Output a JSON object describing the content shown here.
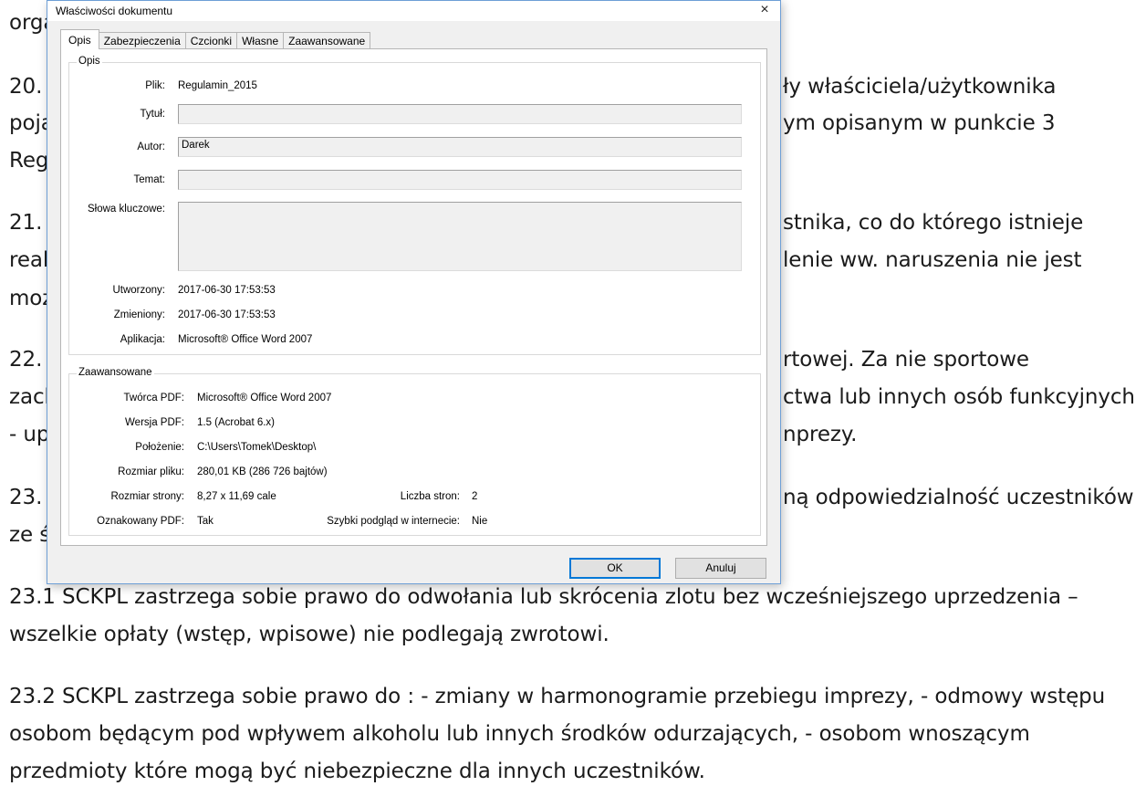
{
  "document": {
    "fragments": [
      {
        "id": "l1",
        "text": "orga"
      },
      {
        "id": "l2a",
        "text": "20."
      },
      {
        "id": "l2b",
        "text": "ły właściciela/użytkownika"
      },
      {
        "id": "l3a",
        "text": "poja"
      },
      {
        "id": "l3b",
        "text": "ym opisanym w punkcie 3"
      },
      {
        "id": "l4a",
        "text": "Reg"
      },
      {
        "id": "l5a",
        "text": "21."
      },
      {
        "id": "l5b",
        "text": "stnika, co do którego istnieje"
      },
      {
        "id": "l6a",
        "text": "real"
      },
      {
        "id": "l6b",
        "text": "lenie ww. naruszenia nie jest"
      },
      {
        "id": "l7a",
        "text": "moż"
      },
      {
        "id": "l8a",
        "text": "22."
      },
      {
        "id": "l8b",
        "text": "rtowej. Za nie sportowe"
      },
      {
        "id": "l9a",
        "text": "zach"
      },
      {
        "id": "l9b",
        "text": "ctwa lub innych osób funkcyjnych"
      },
      {
        "id": "l10a",
        "text": "- up"
      },
      {
        "id": "l10b",
        "text": "nprezy."
      },
      {
        "id": "l11a",
        "text": "23."
      },
      {
        "id": "l11b",
        "text": "ną odpowiedzialność uczestników"
      },
      {
        "id": "l12a",
        "text": "ze ś"
      },
      {
        "id": "l13",
        "text": "23.1 SCKPL zastrzega sobie prawo do odwołania lub skrócenia zlotu bez wcześniejszego uprzedzenia –"
      },
      {
        "id": "l14",
        "text": "wszelkie opłaty (wstęp, wpisowe) nie podlegają zwrotowi."
      },
      {
        "id": "l15",
        "text": "23.2 SCKPL zastrzega sobie prawo do : - zmiany w harmonogramie przebiegu imprezy, - odmowy wstępu"
      },
      {
        "id": "l16",
        "text": "osobom będącym pod wpływem alkoholu lub innych środków odurzających, - osobom wnoszącym"
      },
      {
        "id": "l17",
        "text": "przedmioty które mogą być niebezpieczne dla innych uczestników."
      }
    ]
  },
  "dialog": {
    "title": "Właściwości dokumentu",
    "close_icon": "×",
    "tabs": [
      {
        "label": "Opis",
        "active": true
      },
      {
        "label": "Zabezpieczenia",
        "active": false
      },
      {
        "label": "Czcionki",
        "active": false
      },
      {
        "label": "Własne",
        "active": false
      },
      {
        "label": "Zaawansowane",
        "active": false
      }
    ],
    "opis": {
      "group_title": "Opis",
      "plik_label": "Plik:",
      "plik_value": "Regulamin_2015",
      "tytul_label": "Tytuł:",
      "tytul_value": "",
      "autor_label": "Autor:",
      "autor_value": "Darek",
      "temat_label": "Temat:",
      "temat_value": "",
      "slowa_label": "Słowa kluczowe:",
      "slowa_value": "",
      "utworzony_label": "Utworzony:",
      "utworzony_value": "2017-06-30 17:53:53",
      "zmieniony_label": "Zmieniony:",
      "zmieniony_value": "2017-06-30 17:53:53",
      "aplikacja_label": "Aplikacja:",
      "aplikacja_value": "Microsoft® Office Word 2007"
    },
    "zaawansowane": {
      "group_title": "Zaawansowane",
      "tworca_label": "Twórca PDF:",
      "tworca_value": "Microsoft® Office Word 2007",
      "wersja_label": "Wersja PDF:",
      "wersja_value": "1.5 (Acrobat 6.x)",
      "polozenie_label": "Położenie:",
      "polozenie_value": "C:\\Users\\Tomek\\Desktop\\",
      "rozmiar_pliku_label": "Rozmiar pliku:",
      "rozmiar_pliku_value": "280,01 KB (286 726 bajtów)",
      "rozmiar_strony_label": "Rozmiar strony:",
      "rozmiar_strony_value": "8,27 x 11,69 cale",
      "liczba_stron_label": "Liczba stron:",
      "liczba_stron_value": "2",
      "oznakowany_label": "Oznakowany PDF:",
      "oznakowany_value": "Tak",
      "podglad_label": "Szybki podgląd w internecie:",
      "podglad_value": "Nie"
    },
    "buttons": {
      "ok": "OK",
      "cancel": "Anuluj"
    }
  }
}
